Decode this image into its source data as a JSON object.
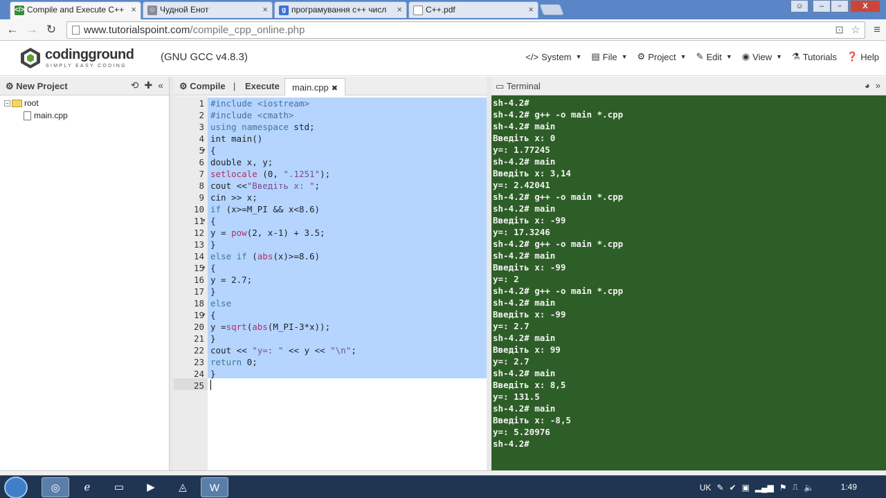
{
  "browser": {
    "tabs": [
      {
        "title": "Compile and Execute C++",
        "favicon": "code-icon",
        "active": true
      },
      {
        "title": "Чудной Енот",
        "favicon": "raccoon-icon",
        "active": false
      },
      {
        "title": "програмування с++ числ",
        "favicon": "google-icon",
        "active": false
      },
      {
        "title": "C++.pdf",
        "favicon": "page-icon",
        "active": false
      }
    ],
    "url_host": "www.tutorialspoint.com",
    "url_path": "/compile_cpp_online.php"
  },
  "site": {
    "logo_name": "codingground",
    "logo_tagline": "SIMPLY EASY CODING",
    "compiler": "(GNU GCC v4.8.3)",
    "menu": [
      {
        "label": "System",
        "icon": "code-icon",
        "caret": true
      },
      {
        "label": "File",
        "icon": "file-icon",
        "caret": true
      },
      {
        "label": "Project",
        "icon": "gear-icon",
        "caret": true
      },
      {
        "label": "Edit",
        "icon": "edit-icon",
        "caret": true
      },
      {
        "label": "View",
        "icon": "eye-icon",
        "caret": true
      },
      {
        "label": "Tutorials",
        "icon": "tutorials-icon",
        "caret": false
      },
      {
        "label": "Help",
        "icon": "help-icon",
        "caret": false
      }
    ]
  },
  "project": {
    "new_project": "New Project",
    "root": "root",
    "file": "main.cpp"
  },
  "editor": {
    "compile": "Compile",
    "separator": "|",
    "execute": "Execute",
    "tab": "main.cpp",
    "lines": [
      "#include <iostream>",
      "#include <cmath>",
      "using namespace std;",
      "int main()",
      "{",
      "double x, y;",
      "setlocale (0, \".1251\");",
      "cout <<\"Введіть x: \";",
      "cin >> x;",
      "if (x>=M_PI && x<8.6)",
      "{",
      "y = pow(2, x-1) + 3.5;",
      "}",
      "else if (abs(x)>=8.6)",
      "{",
      "y = 2.7;",
      "}",
      "else",
      "{",
      "y =sqrt(abs(M_PI-3*x));",
      "}",
      "cout << \"y=: \" << y << \"\\n\";",
      "return 0;",
      "}",
      ""
    ],
    "folds": [
      5,
      11,
      15,
      19
    ]
  },
  "terminal": {
    "title": "Terminal",
    "lines": [
      "sh-4.2#",
      "sh-4.2# g++ -o main *.cpp",
      "sh-4.2# main",
      "Введіть x: 0",
      "y=: 1.77245",
      "sh-4.2# main",
      "Введіть x: 3,14",
      "y=: 2.42041",
      "sh-4.2# g++ -o main *.cpp",
      "sh-4.2# main",
      "Введіть x: -99",
      "y=: 17.3246",
      "sh-4.2# g++ -o main *.cpp",
      "sh-4.2# main",
      "Введіть x: -99",
      "y=: 2",
      "sh-4.2# g++ -o main *.cpp",
      "sh-4.2# main",
      "Введіть x: -99",
      "y=: 2.7",
      "sh-4.2# main",
      "Введіть x: 99",
      "y=: 2.7",
      "sh-4.2# main",
      "Введіть x: 8,5",
      "y=: 131.5",
      "sh-4.2# main",
      "Введіть x: -8,5",
      "y=: 5.20976",
      "sh-4.2#"
    ]
  },
  "taskbar": {
    "language": "UK",
    "clock": "1:49"
  }
}
